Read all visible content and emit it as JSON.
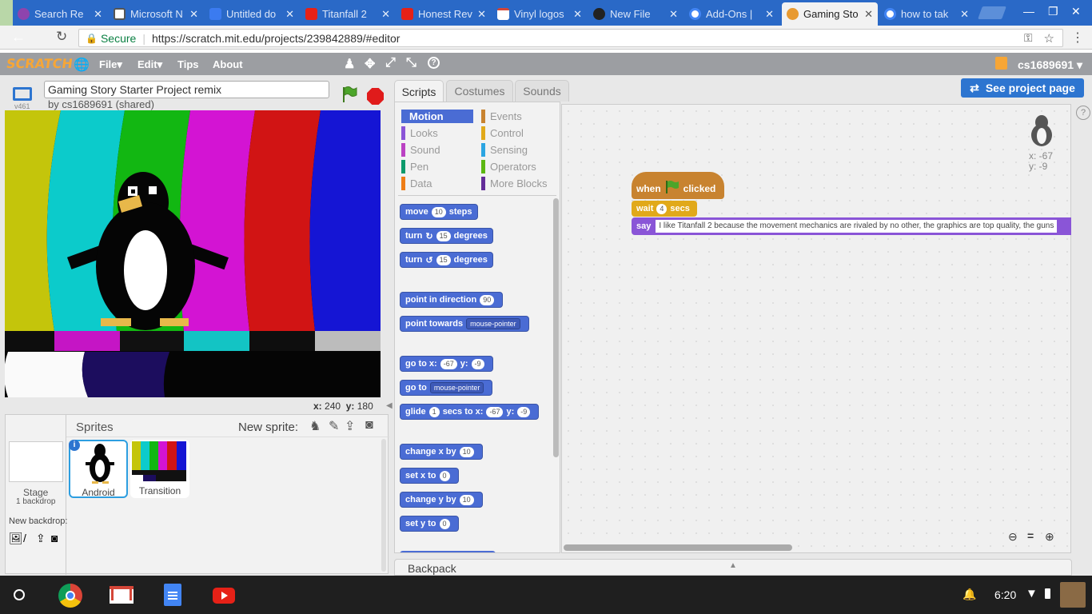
{
  "browser": {
    "tabs": [
      {
        "title": "Search Re",
        "favicon": "twitch-icon",
        "color": "#8e44ad"
      },
      {
        "title": "Microsoft N",
        "favicon": "link-icon",
        "color": "#555555"
      },
      {
        "title": "Untitled do",
        "favicon": "docs-icon",
        "color": "#3b7bf0"
      },
      {
        "title": "Titanfall 2",
        "favicon": "youtube-icon",
        "color": "#e62117"
      },
      {
        "title": "Honest Rev",
        "favicon": "youtube-icon",
        "color": "#e62117"
      },
      {
        "title": "Vinyl logos",
        "favicon": "gmail-icon",
        "color": "#d44638"
      },
      {
        "title": "New File",
        "favicon": "github-icon",
        "color": "#222222"
      },
      {
        "title": "Add-Ons |",
        "favicon": "google-icon",
        "color": "#4285f4"
      },
      {
        "title": "Gaming Sto",
        "favicon": "scratch-icon",
        "color": "#e89a31"
      },
      {
        "title": "how to tak",
        "favicon": "google-icon",
        "color": "#4285f4"
      }
    ],
    "secure_label": "Secure",
    "url": "https://scratch.mit.edu/projects/239842889/#editor"
  },
  "scratch_menu": {
    "logo": "SCRATCH",
    "items": [
      "File",
      "Edit",
      "Tips",
      "About"
    ],
    "user": "cs1689691",
    "see_project_page": "See project page"
  },
  "stage": {
    "version": "v461",
    "project_title": "Gaming Story Starter Project remix",
    "byline": "by cs1689691 (shared)",
    "coords_x_label": "x:",
    "coords_x": "240",
    "coords_y_label": "y:",
    "coords_y": "180"
  },
  "palette_tabs": [
    "Scripts",
    "Costumes",
    "Sounds"
  ],
  "categories": {
    "left": [
      {
        "label": "Motion",
        "color": "#4a6cd4"
      },
      {
        "label": "Looks",
        "color": "#8a55d7"
      },
      {
        "label": "Sound",
        "color": "#bb42c3"
      },
      {
        "label": "Pen",
        "color": "#0e9a6c"
      },
      {
        "label": "Data",
        "color": "#ee7d16"
      }
    ],
    "right": [
      {
        "label": "Events",
        "color": "#c88330"
      },
      {
        "label": "Control",
        "color": "#e1a91a"
      },
      {
        "label": "Sensing",
        "color": "#2ca5e2"
      },
      {
        "label": "Operators",
        "color": "#5cb712"
      },
      {
        "label": "More Blocks",
        "color": "#632d99"
      }
    ]
  },
  "blocks": {
    "move": {
      "a": "move",
      "n": "10",
      "b": "steps"
    },
    "turn_right": {
      "a": "turn",
      "n": "15",
      "b": "degrees"
    },
    "turn_left": {
      "a": "turn",
      "n": "15",
      "b": "degrees"
    },
    "point_dir": {
      "a": "point in direction",
      "n": "90"
    },
    "point_towards": {
      "a": "point towards",
      "d": "mouse-pointer"
    },
    "goto_xy": {
      "a": "go to x:",
      "x": "-67",
      "yl": "y:",
      "y": "-9"
    },
    "goto": {
      "a": "go to",
      "d": "mouse-pointer"
    },
    "glide": {
      "a": "glide",
      "n": "1",
      "b": "secs to x:",
      "x": "-67",
      "yl": "y:",
      "y": "-9"
    },
    "change_x": {
      "a": "change x by",
      "n": "10"
    },
    "set_x": {
      "a": "set x to",
      "n": "0"
    },
    "change_y": {
      "a": "change y by",
      "n": "10"
    },
    "set_y": {
      "a": "set y to",
      "n": "0"
    }
  },
  "script": {
    "when": "when",
    "clicked": "clicked",
    "wait": "wait",
    "wait_n": "4",
    "secs": "secs",
    "say": "say",
    "say_text": "I like Titanfall 2 because the movement mechanics are rivaled by no other, the graphics are top quality, the guns",
    "sprite_x": "x: -67",
    "sprite_y": "y: -9"
  },
  "backpack": "Backpack",
  "sprites": {
    "header": "Sprites",
    "new_sprite": "New sprite:",
    "stage_label": "Stage",
    "stage_sub": "1 backdrop",
    "new_backdrop": "New backdrop:",
    "list": [
      {
        "name": "Android"
      },
      {
        "name": "Transition"
      }
    ]
  },
  "taskbar": {
    "time": "6:20",
    "apps": [
      "chrome-icon",
      "gmail-icon",
      "docs-icon",
      "youtube-icon"
    ]
  }
}
